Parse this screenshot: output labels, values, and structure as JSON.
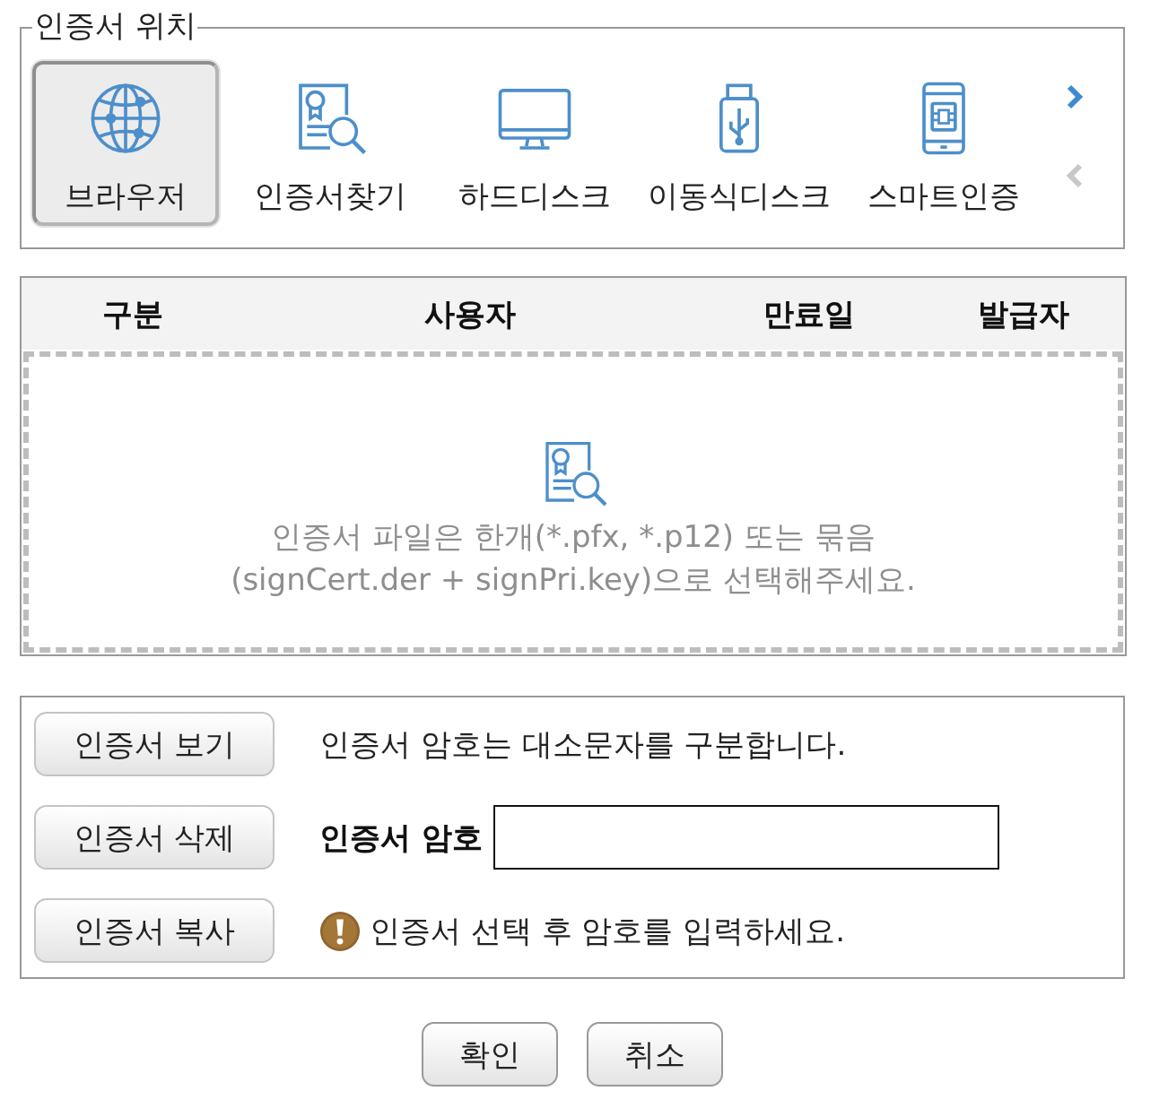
{
  "location": {
    "legend": "인증서 위치",
    "items": [
      {
        "kind": "browser",
        "label": "브라우저",
        "selected": true
      },
      {
        "kind": "finder",
        "label": "인증서찾기",
        "selected": false
      },
      {
        "kind": "harddisk",
        "label": "하드디스크",
        "selected": false
      },
      {
        "kind": "removable",
        "label": "이동식디스크",
        "selected": false
      },
      {
        "kind": "smart",
        "label": "스마트인증",
        "selected": false
      }
    ],
    "arrows": [
      {
        "kind": "next",
        "disabled": false
      },
      {
        "kind": "prev",
        "disabled": true
      }
    ]
  },
  "table": {
    "columns": [
      "구분",
      "사용자",
      "만료일",
      "발급자"
    ],
    "empty_message": [
      "인증서 파일은 한개(*.pfx, *.p12) 또는 묶음",
      "(signCert.der + signPri.key)으로 선택해주세요."
    ]
  },
  "certificate_panel": {
    "buttons": [
      "인증서 보기",
      "인증서 삭제",
      "인증서 복사"
    ],
    "case_note": "인증서 암호는 대소문자를 구분합니다.",
    "password": {
      "label": "인증서 암호"
    },
    "warning": "인증서 선택 후 암호를 입력하세요."
  },
  "dialog_buttons": [
    "확인",
    "취소"
  ]
}
